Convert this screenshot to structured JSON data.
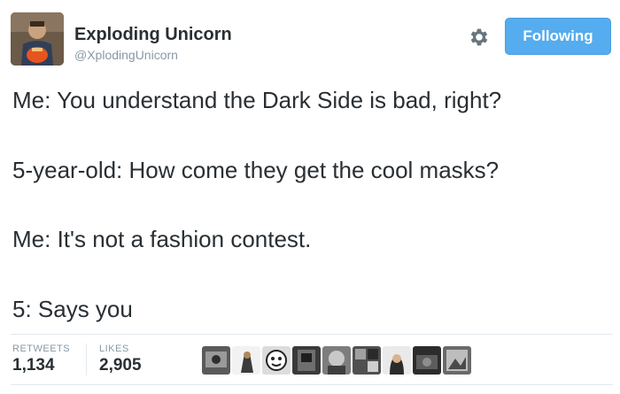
{
  "user": {
    "display_name": "Exploding Unicorn",
    "handle": "@XplodingUnicorn",
    "follow_label": "Following"
  },
  "tweet": {
    "lines": [
      "Me: You understand the Dark Side is bad, right?",
      "5-year-old: How come they get the cool masks?",
      "Me: It's not a fashion contest.",
      "5: Says you"
    ]
  },
  "stats": {
    "retweets_label": "RETWEETS",
    "retweets_count": "1,134",
    "likes_label": "LIKES",
    "likes_count": "2,905"
  },
  "colors": {
    "follow_button": "#55acee",
    "text": "#292f33",
    "muted": "#8899a6",
    "divider": "#e1e8ed"
  },
  "icons": {
    "settings": "gear-icon"
  },
  "likers": [
    {
      "name": "liker-avatar-1"
    },
    {
      "name": "liker-avatar-2"
    },
    {
      "name": "liker-avatar-3"
    },
    {
      "name": "liker-avatar-4"
    },
    {
      "name": "liker-avatar-5"
    },
    {
      "name": "liker-avatar-6"
    },
    {
      "name": "liker-avatar-7"
    },
    {
      "name": "liker-avatar-8"
    },
    {
      "name": "liker-avatar-9"
    }
  ]
}
